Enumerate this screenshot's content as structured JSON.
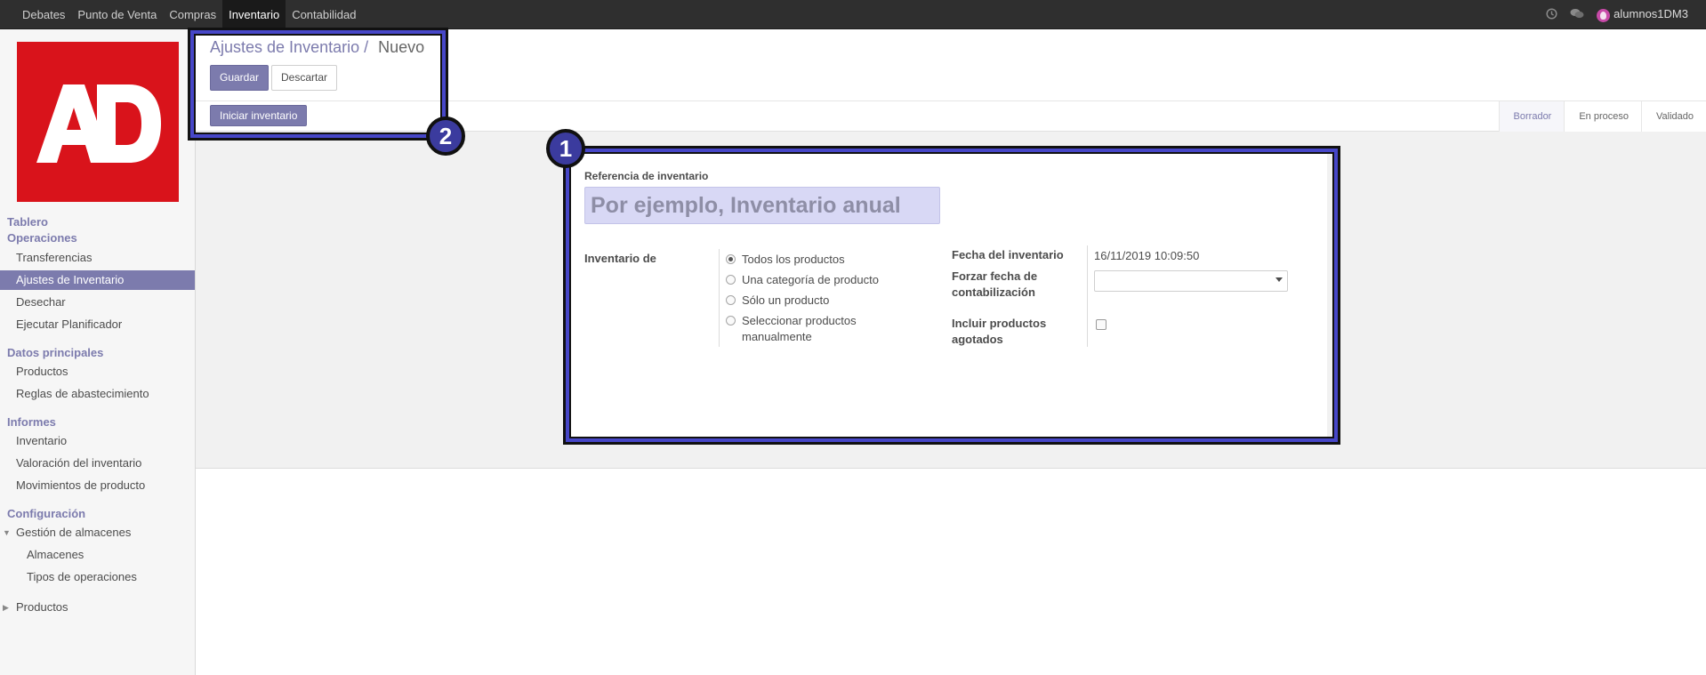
{
  "topbar": {
    "menu": [
      "Debates",
      "Punto de Venta",
      "Compras",
      "Inventario",
      "Contabilidad"
    ],
    "active": "Inventario",
    "user": "alumnos1DM3"
  },
  "logo_text": "AD",
  "sidebar": {
    "tablero": "Tablero",
    "operaciones": "Operaciones",
    "op_items": [
      "Transferencias",
      "Ajustes de Inventario",
      "Desechar",
      "Ejecutar Planificador"
    ],
    "datos": "Datos principales",
    "datos_items": [
      "Productos",
      "Reglas de abastecimiento"
    ],
    "informes": "Informes",
    "informes_items": [
      "Inventario",
      "Valoración del inventario",
      "Movimientos de producto"
    ],
    "config": "Configuración",
    "gestion": "Gestión de almacenes",
    "gestion_items": [
      "Almacenes",
      "Tipos de operaciones"
    ],
    "productos": "Productos"
  },
  "breadcrumb": {
    "parent": "Ajustes de Inventario",
    "separator": "/",
    "current": "Nuevo"
  },
  "buttons": {
    "save": "Guardar",
    "discard": "Descartar",
    "start": "Iniciar inventario"
  },
  "statusbar": [
    "Borrador",
    "En proceso",
    "Validado"
  ],
  "form": {
    "ref_label": "Referencia de inventario",
    "ref_placeholder": "Por ejemplo, Inventario anual",
    "inv_label": "Inventario de",
    "options": [
      "Todos los productos",
      "Una categoría de producto",
      "Sólo un producto",
      "Seleccionar productos manualmente"
    ],
    "selected_option": "Todos los productos",
    "date_label": "Fecha del inventario",
    "date_value": "16/11/2019 10:09:50",
    "force_label": "Forzar fecha de contabilización",
    "force_value": "",
    "include_label": "Incluir productos agotados",
    "include_checked": false
  },
  "badges": [
    "1",
    "2"
  ],
  "colors": {
    "accent": "#7c7bad",
    "highlight": "#4747c8",
    "logo": "#d9131b",
    "topbar": "#2f2f2f"
  }
}
